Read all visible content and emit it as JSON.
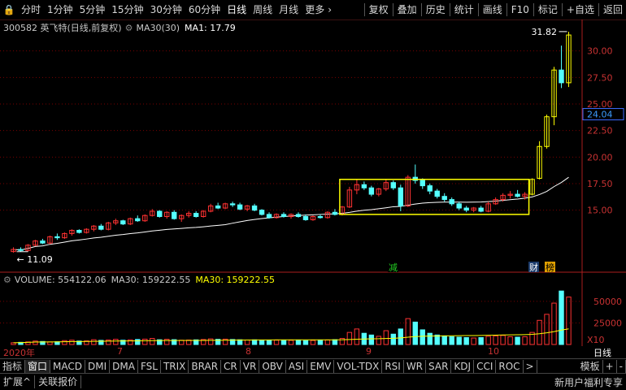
{
  "toolbar": {
    "left_items": [
      "分时",
      "1分钟",
      "5分钟",
      "15分钟",
      "30分钟",
      "60分钟",
      "日线",
      "周线",
      "月线",
      "更多"
    ],
    "more_arrow": "›",
    "right_items": [
      "复权",
      "叠加",
      "历史",
      "统计",
      "画线",
      "F10",
      "标记",
      "+自选",
      "返回"
    ]
  },
  "chart_header": {
    "stock": "300582 英飞特(日线,前复权)",
    "ma30_label": "MA30(30)",
    "ma1_label": "MA1: 17.79"
  },
  "volume_header": {
    "volume": "VOLUME: 554122.06",
    "ma30_a": "MA30: 159222.55",
    "ma30_b": "MA30: 159222.55"
  },
  "price_axis": {
    "labels": [
      "30.00",
      "27.50",
      "25.00",
      "22.50",
      "20.00",
      "17.50",
      "15.00"
    ],
    "current": "24.04"
  },
  "volume_axis": {
    "labels": [
      "50000",
      "25000"
    ],
    "unit": "X10"
  },
  "annotations": {
    "high": "31.82",
    "low": "11.09",
    "mark1": "减",
    "mark2": "财",
    "mark3": "榜"
  },
  "x_axis": {
    "labels": [
      "2020年",
      "7",
      "8",
      "9",
      "10"
    ],
    "right": "日线"
  },
  "indicator_tabs": [
    "指标",
    "窗口",
    "MACD",
    "DMI",
    "DMA",
    "FSL",
    "TRIX",
    "BRAR",
    "CR",
    "VR",
    "OBV",
    "ASI",
    "EMV",
    "VOL-TDX",
    "RSI",
    "WR",
    "SAR",
    "KDJ",
    "CCI",
    "ROC",
    ">"
  ],
  "indicator_right": [
    "模板",
    "+",
    "-"
  ],
  "bottom": {
    "left": [
      "扩展^",
      "关联报价"
    ],
    "right": "新用户福利专享"
  },
  "colors": {
    "up": "#ff3232",
    "down": "#54ffff",
    "ma": "#ffffff",
    "ma_vol": "#ffff00",
    "box": "#ffff00",
    "grid": "#7a0000"
  },
  "chart_data": {
    "type": "candlestick",
    "price_ylim": [
      10,
      32.5
    ],
    "volume_ylim": [
      0,
      65000
    ],
    "candles": [
      [
        11.1,
        11.5,
        11.0,
        11.3
      ],
      [
        11.3,
        11.5,
        11.1,
        11.2
      ],
      [
        11.2,
        11.8,
        11.1,
        11.7
      ],
      [
        11.7,
        12.2,
        11.6,
        12.1
      ],
      [
        12.1,
        12.3,
        11.8,
        11.9
      ],
      [
        11.9,
        12.6,
        11.8,
        12.5
      ],
      [
        12.5,
        12.8,
        12.2,
        12.4
      ],
      [
        12.4,
        12.9,
        12.3,
        12.8
      ],
      [
        12.8,
        13.2,
        12.6,
        13.1
      ],
      [
        13.1,
        13.2,
        12.8,
        12.9
      ],
      [
        12.9,
        13.3,
        12.8,
        13.2
      ],
      [
        13.2,
        13.6,
        13.0,
        13.5
      ],
      [
        13.5,
        13.7,
        13.1,
        13.2
      ],
      [
        13.2,
        13.9,
        13.1,
        13.8
      ],
      [
        13.8,
        14.2,
        13.6,
        14.0
      ],
      [
        14.0,
        14.1,
        13.6,
        13.7
      ],
      [
        13.7,
        14.3,
        13.6,
        14.2
      ],
      [
        14.2,
        14.5,
        13.9,
        14.0
      ],
      [
        14.0,
        14.6,
        13.9,
        14.5
      ],
      [
        14.5,
        15.1,
        14.4,
        14.9
      ],
      [
        14.9,
        15.0,
        14.3,
        14.4
      ],
      [
        14.4,
        14.9,
        14.2,
        14.8
      ],
      [
        14.8,
        15.0,
        14.1,
        14.2
      ],
      [
        14.2,
        14.6,
        13.9,
        14.5
      ],
      [
        14.5,
        14.9,
        14.3,
        14.7
      ],
      [
        14.7,
        14.9,
        14.3,
        14.4
      ],
      [
        14.4,
        15.0,
        14.3,
        14.9
      ],
      [
        14.9,
        15.6,
        14.8,
        15.4
      ],
      [
        15.4,
        15.7,
        15.1,
        15.2
      ],
      [
        15.2,
        15.7,
        15.1,
        15.6
      ],
      [
        15.6,
        15.8,
        15.3,
        15.5
      ],
      [
        15.5,
        15.7,
        15.0,
        15.1
      ],
      [
        15.1,
        15.5,
        14.9,
        15.4
      ],
      [
        15.4,
        15.6,
        14.9,
        15.0
      ],
      [
        15.0,
        15.1,
        14.5,
        14.6
      ],
      [
        14.6,
        14.8,
        14.2,
        14.3
      ],
      [
        14.3,
        14.7,
        14.2,
        14.6
      ],
      [
        14.6,
        14.8,
        14.3,
        14.4
      ],
      [
        14.4,
        14.7,
        14.2,
        14.6
      ],
      [
        14.6,
        14.8,
        14.3,
        14.4
      ],
      [
        14.4,
        14.6,
        14.0,
        14.1
      ],
      [
        14.1,
        14.5,
        14.0,
        14.4
      ],
      [
        14.4,
        14.6,
        14.2,
        14.3
      ],
      [
        14.3,
        14.9,
        14.2,
        14.8
      ],
      [
        14.8,
        15.1,
        14.5,
        14.6
      ],
      [
        14.6,
        15.4,
        14.5,
        15.3
      ],
      [
        15.3,
        17.2,
        15.2,
        16.9
      ],
      [
        16.9,
        17.9,
        16.5,
        17.4
      ],
      [
        17.4,
        17.7,
        16.9,
        17.1
      ],
      [
        17.1,
        17.3,
        16.3,
        16.5
      ],
      [
        16.5,
        17.1,
        16.3,
        17.0
      ],
      [
        17.0,
        17.9,
        16.8,
        17.6
      ],
      [
        17.6,
        17.8,
        16.9,
        17.1
      ],
      [
        17.1,
        17.4,
        14.9,
        15.4
      ],
      [
        15.4,
        18.3,
        15.3,
        18.1
      ],
      [
        18.1,
        19.3,
        17.5,
        17.8
      ],
      [
        17.8,
        18.0,
        17.0,
        17.3
      ],
      [
        17.3,
        17.5,
        16.5,
        16.8
      ],
      [
        16.8,
        17.0,
        16.1,
        16.3
      ],
      [
        16.3,
        16.6,
        15.8,
        16.0
      ],
      [
        16.0,
        16.2,
        15.4,
        15.6
      ],
      [
        15.6,
        15.8,
        15.0,
        15.2
      ],
      [
        15.2,
        15.4,
        14.8,
        15.0
      ],
      [
        15.0,
        15.3,
        14.8,
        15.2
      ],
      [
        15.2,
        15.4,
        14.8,
        14.9
      ],
      [
        14.9,
        15.8,
        14.8,
        15.6
      ],
      [
        15.6,
        16.2,
        15.5,
        16.0
      ],
      [
        16.0,
        16.6,
        15.8,
        16.4
      ],
      [
        16.4,
        16.8,
        16.1,
        16.5
      ],
      [
        16.5,
        16.9,
        16.2,
        16.3
      ],
      [
        16.3,
        16.7,
        16.0,
        16.5
      ],
      [
        16.5,
        18.0,
        16.4,
        17.9
      ],
      [
        18.0,
        21.5,
        17.9,
        21.0
      ],
      [
        21.0,
        24.0,
        20.8,
        23.8
      ],
      [
        23.8,
        28.5,
        23.0,
        28.2
      ],
      [
        28.2,
        30.5,
        26.5,
        27.0
      ],
      [
        27.0,
        31.8,
        26.6,
        31.5
      ]
    ],
    "volumes": [
      2000,
      2500,
      3000,
      4000,
      3500,
      3000,
      3200,
      4500,
      5000,
      4000,
      4200,
      5500,
      4800,
      5200,
      6000,
      5000,
      5400,
      5800,
      6200,
      7000,
      5500,
      6000,
      5600,
      5000,
      5200,
      5400,
      5800,
      6500,
      6000,
      6200,
      5800,
      5500,
      5200,
      5400,
      5000,
      4800,
      5000,
      4600,
      4800,
      5000,
      4500,
      4700,
      4800,
      5200,
      5600,
      7000,
      14000,
      18000,
      13000,
      11000,
      9500,
      16000,
      12000,
      18000,
      30000,
      26000,
      17000,
      13000,
      11000,
      10000,
      9000,
      8500,
      8000,
      7500,
      8000,
      9500,
      10000,
      10500,
      9000,
      8500,
      9000,
      14000,
      28000,
      35000,
      48000,
      62000,
      55000
    ]
  }
}
